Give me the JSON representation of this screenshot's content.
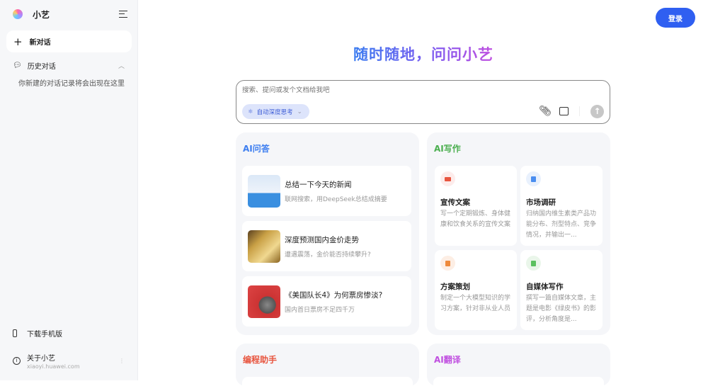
{
  "sidebar": {
    "app_name": "小艺",
    "new_chat": "新对话",
    "history": "历史对话",
    "history_empty": "你新建的对话记录将会出现在这里",
    "download": "下载手机版",
    "about": "关于小艺",
    "about_url": "xiaoyi.huawei.com"
  },
  "header": {
    "login": "登录"
  },
  "hero": {
    "title": "随时随地，问问小艺"
  },
  "input": {
    "placeholder": "搜索、提问或发个文档给我吧",
    "mode": "自动深度思考"
  },
  "qa": {
    "title": "AI问答",
    "items": [
      {
        "title": "总结一下今天的新闻",
        "subtitle": "联网搜索，用DeepSeek总结成摘要"
      },
      {
        "title": "深度预测国内金价走势",
        "subtitle": "遭遇震荡，金价能否持续攀升?"
      },
      {
        "title": "《美国队长4》为何票房惨淡?",
        "subtitle": "国内首日票房不足四千万"
      }
    ]
  },
  "writing": {
    "title": "AI写作",
    "items": [
      {
        "title": "宣传文案",
        "subtitle": "写一个定期锻炼、身体健康和饮食关系的宣传文案",
        "color": "#e8553f",
        "bg": "#fdeceb"
      },
      {
        "title": "市场调研",
        "subtitle": "归纳国内维生素类产品功能分布、剂型特点、竞争情况，并输出一...",
        "color": "#4a8ef0",
        "bg": "#e9f1fd"
      },
      {
        "title": "方案策划",
        "subtitle": "制定一个大模型知识的学习方案，针对非从业人员",
        "color": "#ee8a3c",
        "bg": "#fdeee4"
      },
      {
        "title": "自媒体写作",
        "subtitle": "撰写一篇自媒体文章，主题是电影《绿皮书》的影评，分析角度是...",
        "color": "#5cc160",
        "bg": "#eaf6ea"
      }
    ]
  },
  "coding": {
    "title": "编程助手"
  },
  "translate": {
    "title": "AI翻译"
  },
  "colors": {
    "qa": "#3d7ef0",
    "writing": "#4caf50",
    "coding": "#e8553f",
    "translate": "#c04fe0"
  }
}
